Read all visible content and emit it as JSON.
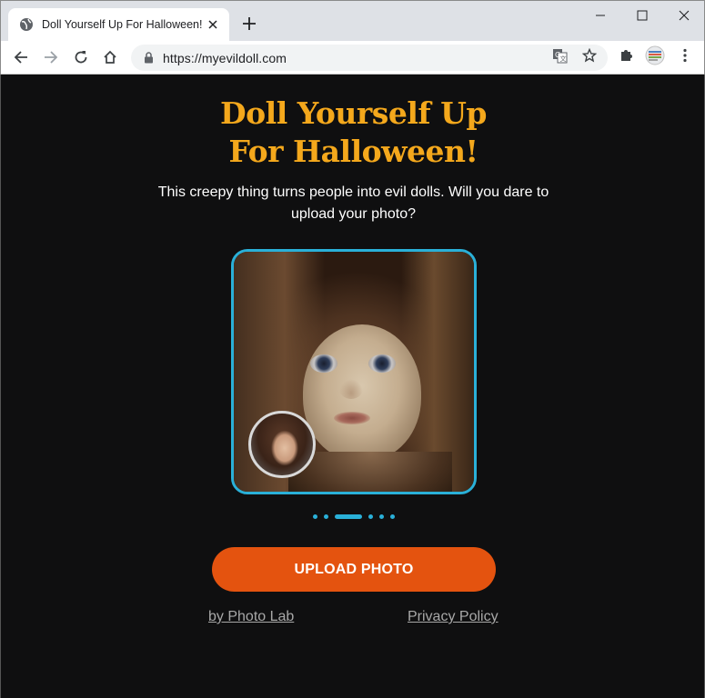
{
  "browser": {
    "tab_title": "Doll Yourself Up For Halloween!",
    "new_tab_symbol": "+",
    "url": "https://myevildoll.com",
    "icons": {
      "tab": "globe-icon",
      "close": "close-icon",
      "back": "back-arrow-icon",
      "forward": "forward-arrow-icon",
      "reload": "reload-icon",
      "home": "home-icon",
      "lock": "lock-icon",
      "translate": "translate-icon",
      "bookmark": "star-icon",
      "extensions": "puzzle-icon",
      "profile": "profile-icon",
      "menu": "kebab-menu-icon",
      "minimize": "minimize-icon",
      "maximize": "maximize-icon",
      "window_close": "window-close-icon"
    }
  },
  "hero": {
    "title": "Doll Yourself Up For Halloween!",
    "subtitle": "This creepy thing turns people into evil dolls. Will you dare to upload your photo?"
  },
  "carousel": {
    "slide_count": 6,
    "active_index": 2,
    "accent_color": "#2ab0d8"
  },
  "actions": {
    "upload_label": "UPLOAD PHOTO",
    "upload_color": "#e4530f"
  },
  "footer": {
    "credit_label": "by Photo Lab",
    "privacy_label": "Privacy Policy"
  },
  "colors": {
    "title": "#f4a81c",
    "background": "#0f0f10"
  }
}
